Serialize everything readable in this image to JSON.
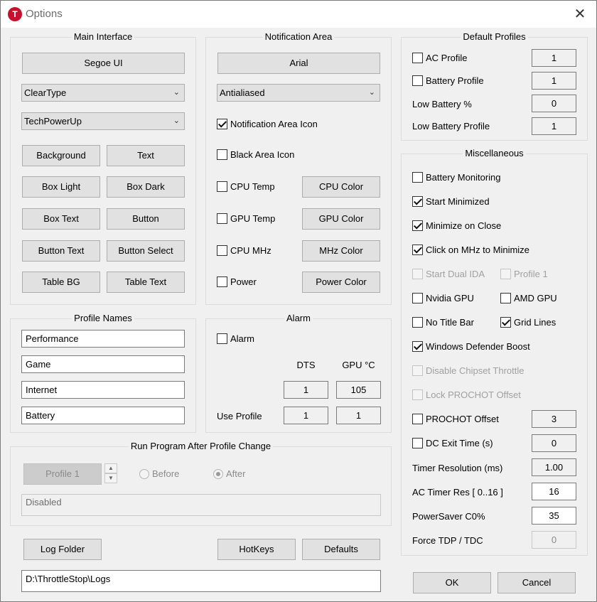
{
  "window": {
    "title": "Options",
    "app_icon_letter": "T",
    "close_glyph": "✕"
  },
  "main_interface": {
    "label": "Main Interface",
    "font_button": "Segoe UI",
    "rendering": "ClearType",
    "theme": "TechPowerUp",
    "color_buttons": [
      "Background",
      "Text",
      "Box Light",
      "Box Dark",
      "Box Text",
      "Button",
      "Button Text",
      "Button Select",
      "Table BG",
      "Table Text"
    ]
  },
  "notification_area": {
    "label": "Notification Area",
    "font_button": "Arial",
    "rendering": "Antialiased",
    "notification_area_icon": {
      "label": "Notification Area Icon",
      "checked": true
    },
    "black_area_icon": {
      "label": "Black Area Icon",
      "checked": false
    },
    "rows": [
      {
        "check_label": "CPU Temp",
        "checked": false,
        "button": "CPU Color"
      },
      {
        "check_label": "GPU Temp",
        "checked": false,
        "button": "GPU Color"
      },
      {
        "check_label": "CPU MHz",
        "checked": false,
        "button": "MHz Color"
      },
      {
        "check_label": "Power",
        "checked": false,
        "button": "Power Color"
      }
    ]
  },
  "default_profiles": {
    "label": "Default Profiles",
    "ac_profile": {
      "label": "AC Profile",
      "checked": false,
      "value": "1"
    },
    "battery_profile": {
      "label": "Battery Profile",
      "checked": false,
      "value": "1"
    },
    "low_battery_pct": {
      "label": "Low Battery %",
      "value": "0"
    },
    "low_battery_profile": {
      "label": "Low Battery Profile",
      "value": "1"
    }
  },
  "miscellaneous": {
    "label": "Miscellaneous",
    "battery_monitoring": {
      "label": "Battery Monitoring",
      "checked": false
    },
    "start_minimized": {
      "label": "Start Minimized",
      "checked": true
    },
    "minimize_on_close": {
      "label": "Minimize on Close",
      "checked": true
    },
    "click_mhz_minimize": {
      "label": "Click on MHz to Minimize",
      "checked": true
    },
    "start_dual_ida": {
      "label": "Start Dual IDA",
      "checked": false,
      "disabled": true
    },
    "profile_1": {
      "label": "Profile 1",
      "checked": false,
      "disabled": true
    },
    "nvidia_gpu": {
      "label": "Nvidia GPU",
      "checked": false
    },
    "amd_gpu": {
      "label": "AMD GPU",
      "checked": false
    },
    "no_title_bar": {
      "label": "No Title Bar",
      "checked": false
    },
    "grid_lines": {
      "label": "Grid Lines",
      "checked": true
    },
    "windows_defender_boost": {
      "label": "Windows Defender Boost",
      "checked": true
    },
    "disable_chipset_throttle": {
      "label": "Disable Chipset Throttle",
      "checked": false,
      "disabled": true
    },
    "lock_prochot_offset": {
      "label": "Lock PROCHOT Offset",
      "checked": false,
      "disabled": true
    },
    "prochot_offset": {
      "label": "PROCHOT Offset",
      "checked": false,
      "value": "3"
    },
    "dc_exit_time": {
      "label": "DC Exit Time (s)",
      "checked": false,
      "value": "0"
    },
    "timer_resolution": {
      "label": "Timer Resolution (ms)",
      "value": "1.00"
    },
    "ac_timer_res": {
      "label": "AC Timer Res [ 0..16 ]",
      "value": "16"
    },
    "powersaver_c0": {
      "label": "PowerSaver C0%",
      "value": "35"
    },
    "force_tdp_tdc": {
      "label": "Force TDP / TDC",
      "value": "0"
    }
  },
  "profile_names": {
    "label": "Profile Names",
    "names": [
      "Performance",
      "Game",
      "Internet",
      "Battery"
    ]
  },
  "alarm": {
    "label": "Alarm",
    "alarm_check": {
      "label": "Alarm",
      "checked": false
    },
    "col_dts": "DTS",
    "col_gpu": "GPU °C",
    "dts_value": "1",
    "gpu_value": "105",
    "use_profile_label": "Use Profile",
    "use_profile_dts": "1",
    "use_profile_gpu": "1"
  },
  "run_program": {
    "label": "Run Program After Profile Change",
    "profile_button": "Profile 1",
    "before_label": "Before",
    "after_label": "After",
    "after_selected": true,
    "command": "Disabled"
  },
  "bottom": {
    "log_folder": "Log Folder",
    "hotkeys": "HotKeys",
    "defaults": "Defaults",
    "log_path": "D:\\ThrottleStop\\Logs",
    "ok": "OK",
    "cancel": "Cancel"
  }
}
